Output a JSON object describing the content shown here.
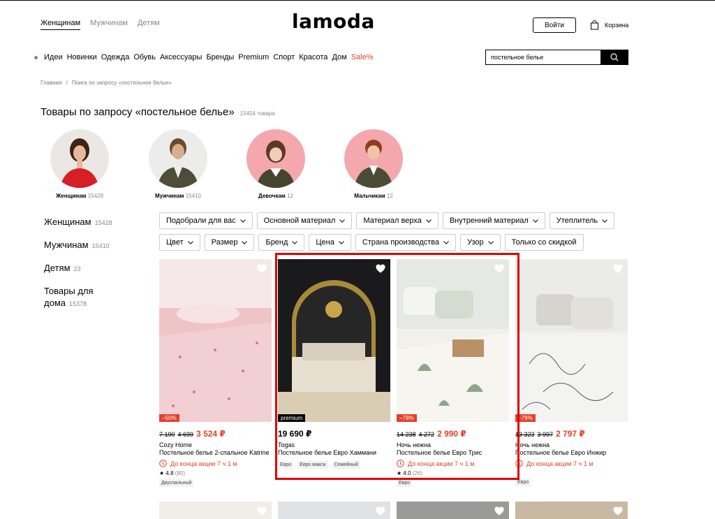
{
  "header": {
    "gender_tabs": [
      "Женщинам",
      "Мужчинам",
      "Детям"
    ],
    "logo": "lamoda",
    "login_label": "Войти",
    "cart_label": "Корзина"
  },
  "nav": {
    "items": [
      "Идеи",
      "Новинки",
      "Одежда",
      "Обувь",
      "Аксессуары",
      "Бренды",
      "Premium",
      "Спорт",
      "Красота",
      "Дом"
    ],
    "sale_label": "Sale%"
  },
  "search": {
    "value": "постельное белье"
  },
  "breadcrumb": {
    "home": "Главная",
    "sep": "/",
    "current": "Поиск по запросу «постельное белье»"
  },
  "page": {
    "title": "Товары по запросу «постельное белье»",
    "count": "15454 товара"
  },
  "categories": [
    {
      "label": "Женщинам",
      "count": "15428"
    },
    {
      "label": "Мужчинам",
      "count": "15410"
    },
    {
      "label": "Девочкам",
      "count": "12"
    },
    {
      "label": "Мальчикам",
      "count": "12"
    }
  ],
  "sidebar": [
    {
      "label": "Женщинам",
      "count": "15428"
    },
    {
      "label": "Мужчинам",
      "count": "15410"
    },
    {
      "label": "Детям",
      "count": "23"
    },
    {
      "label": "Товары для дома",
      "count": "15378"
    }
  ],
  "filters_row1": [
    "Подобрали для вас",
    "Основной материал",
    "Материал верха",
    "Внутренний материал",
    "Утеплитель"
  ],
  "filters_row2": [
    "Цвет",
    "Размер",
    "Бренд",
    "Цена",
    "Страна производства",
    "Узор"
  ],
  "filters_row2_plain": "Только со скидкой",
  "products": [
    {
      "badge": "−50%",
      "old1": "7 190",
      "old2": "4 699",
      "price": "3 524 ₽",
      "brand": "Cozy Home",
      "name": "Постельное белье 2-спальное Katrine",
      "promo": "До конца акции 7 ч 1 м",
      "rating": "★ 4.8",
      "reviews": "(80)",
      "tags": [
        "Двуспальный"
      ]
    },
    {
      "badge": "premium",
      "price": "19 690 ₽",
      "brand": "Togas",
      "name": "Постельное белье Евро Хаммани",
      "tags": [
        "Евро",
        "Евро макси",
        "Семейный"
      ]
    },
    {
      "badge": "−78%",
      "old1": "14 238",
      "old2": "4 272",
      "price": "2 990 ₽",
      "brand": "Ночь нежна",
      "name": "Постельное белье Евро Трис",
      "promo": "До конца акции 7 ч 1 м",
      "rating": "★ 4.0",
      "reviews": "(26)",
      "tags": [
        "Евро"
      ]
    },
    {
      "badge": "−79%",
      "old1": "13 323",
      "old2": "3 997",
      "price": "2 797 ₽",
      "brand": "Ночь нежна",
      "name": "Постельное белье Евро Инжир",
      "promo": "До конца акции 7 ч 1 м",
      "tags": [
        "Евро"
      ]
    }
  ],
  "colors": {
    "accent": "#e2412b",
    "highlight": "#e00000"
  },
  "icons": [
    "bag-icon",
    "search-icon",
    "heart-icon",
    "clock-icon",
    "chevron-down-icon"
  ]
}
